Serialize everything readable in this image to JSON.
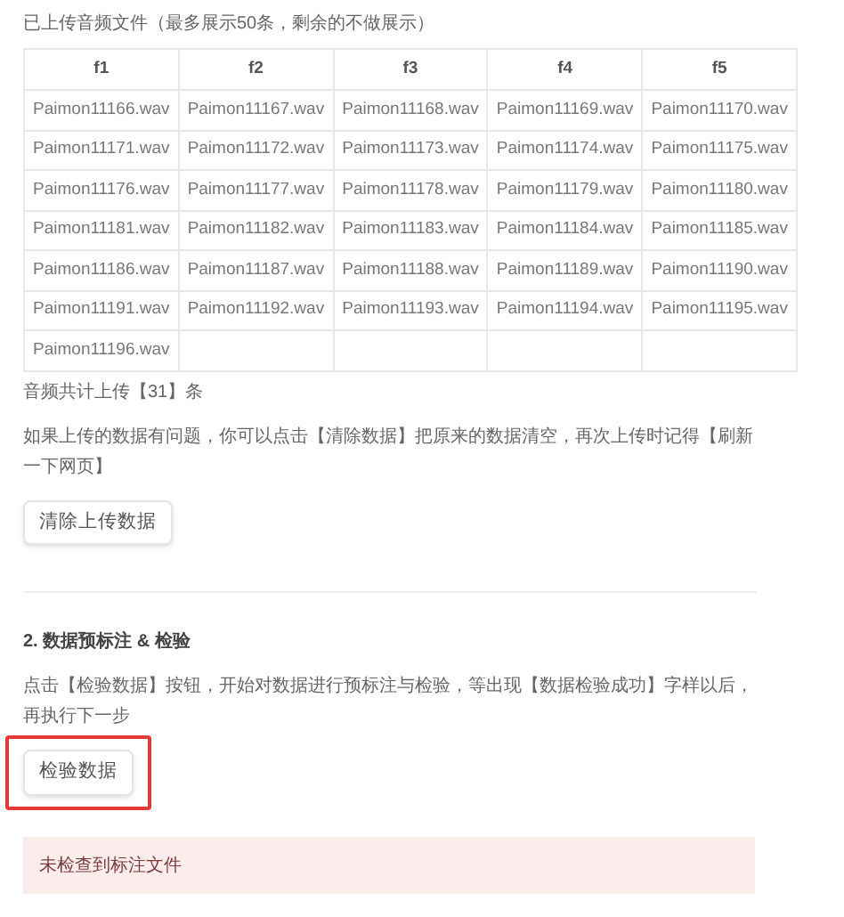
{
  "files_caption": "已上传音频文件（最多展示50条，剩余的不做展示）",
  "table": {
    "columns": [
      "f1",
      "f2",
      "f3",
      "f4",
      "f5"
    ],
    "rows": [
      [
        "Paimon11166.wav",
        "Paimon11167.wav",
        "Paimon11168.wav",
        "Paimon11169.wav",
        "Paimon11170.wav"
      ],
      [
        "Paimon11171.wav",
        "Paimon11172.wav",
        "Paimon11173.wav",
        "Paimon11174.wav",
        "Paimon11175.wav"
      ],
      [
        "Paimon11176.wav",
        "Paimon11177.wav",
        "Paimon11178.wav",
        "Paimon11179.wav",
        "Paimon11180.wav"
      ],
      [
        "Paimon11181.wav",
        "Paimon11182.wav",
        "Paimon11183.wav",
        "Paimon11184.wav",
        "Paimon11185.wav"
      ],
      [
        "Paimon11186.wav",
        "Paimon11187.wav",
        "Paimon11188.wav",
        "Paimon11189.wav",
        "Paimon11190.wav"
      ],
      [
        "Paimon11191.wav",
        "Paimon11192.wav",
        "Paimon11193.wav",
        "Paimon11194.wav",
        "Paimon11195.wav"
      ],
      [
        "Paimon11196.wav",
        "",
        "",
        "",
        ""
      ]
    ]
  },
  "total_text": "音频共计上传【31】条",
  "clear_hint": "如果上传的数据有问题，你可以点击【清除数据】把原来的数据清空，再次上传时记得【刷新一下网页】",
  "clear_button": {
    "label": "清除上传数据",
    "highlighted": false
  },
  "section": {
    "title": "2. 数据预标注 & 检验",
    "hint": "点击【检验数据】按钮，开始对数据进行预标注与检验，等出现【数据检验成功】字样以后，再执行下一步",
    "button": {
      "label": "检验数据",
      "highlighted": true
    },
    "alert": {
      "kind": "error",
      "text": "未检查到标注文件"
    }
  }
}
